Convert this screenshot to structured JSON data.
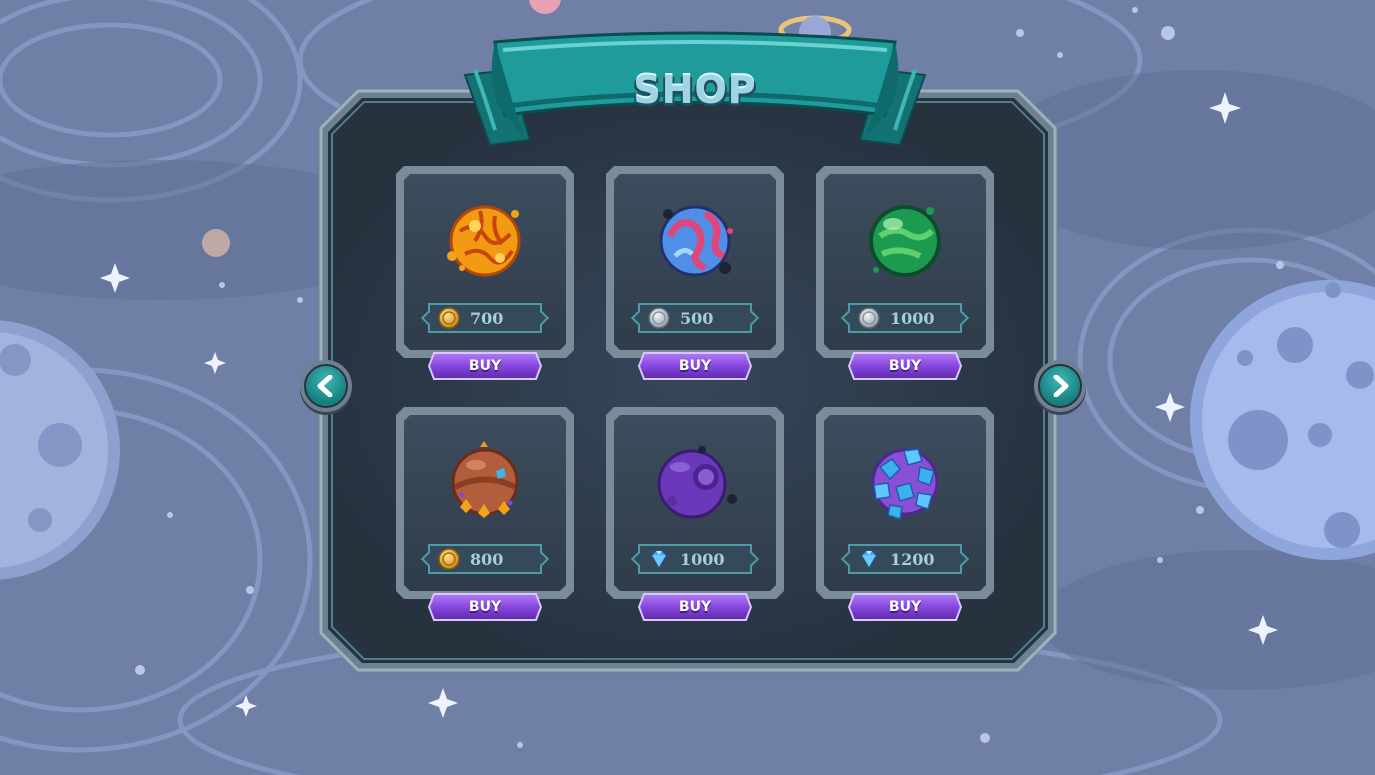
{
  "screen": {
    "title": "SHOP"
  },
  "colors": {
    "ribbon": "#1f9b9b",
    "panel_frame": "#6f8190",
    "buy_button": "#8a4ee0",
    "price_text": "#a6cfd9",
    "background": "#6f7fa6"
  },
  "navigation": {
    "prev_icon": "chevron-left-icon",
    "next_icon": "chevron-right-icon"
  },
  "items": [
    {
      "planet": "molten-orange-planet",
      "currency": "gold-coin-icon",
      "price": "700",
      "buy_label": "BUY"
    },
    {
      "planet": "blue-red-swirl-planet",
      "currency": "silver-coin-icon",
      "price": "500",
      "buy_label": "BUY"
    },
    {
      "planet": "green-glass-planet",
      "currency": "silver-coin-icon",
      "price": "1000",
      "buy_label": "BUY"
    },
    {
      "planet": "brown-crystal-planet",
      "currency": "gold-coin-icon",
      "price": "800",
      "buy_label": "BUY"
    },
    {
      "planet": "purple-cratered-planet",
      "currency": "diamond-icon",
      "price": "1000",
      "buy_label": "BUY"
    },
    {
      "planet": "blue-rock-planet",
      "currency": "diamond-icon",
      "price": "1200",
      "buy_label": "BUY"
    }
  ]
}
